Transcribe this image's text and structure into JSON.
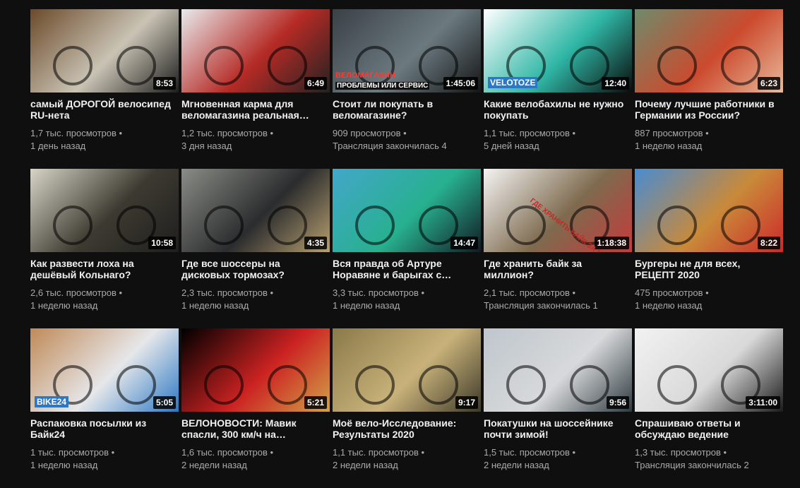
{
  "videos": [
    {
      "title": "самый ДОРОГОЙ велосипед RU-нета",
      "duration": "8:53",
      "views": "1,7 тыс. просмотров •",
      "age": "1 день назад",
      "thumb_colors": [
        "#6b4a2a",
        "#c9c3b4",
        "#1d1d1d"
      ]
    },
    {
      "title": "Мгновенная карма для веломагазина реальная…",
      "duration": "6:49",
      "views": "1,2 тыс. просмотров •",
      "age": "3 дня назад",
      "thumb_colors": [
        "#e9eaec",
        "#b52a25",
        "#222222"
      ]
    },
    {
      "title": "Стоит ли покупать в веломагазине?",
      "duration": "1:45:06",
      "views": "909 просмотров •",
      "age": "Трансляция закончилась 4",
      "thumb_colors": [
        "#3a4046",
        "#6b7a80",
        "#151515"
      ],
      "overlay_top": "ВЕЛОМАГАЗИН",
      "overlay_bottom": "ПРОБЛЕМЫ ИЛИ СЕРВИС"
    },
    {
      "title": "Какие велобахилы не нужно покупать",
      "duration": "12:40",
      "views": "1,1 тыс. просмотров •",
      "age": "5 дней назад",
      "thumb_colors": [
        "#ffffff",
        "#2fb6a5",
        "#0b0b0b"
      ],
      "overlay_logo": "VELOTOZE"
    },
    {
      "title": "Почему лучшие работники в Германии из России?",
      "duration": "6:23",
      "views": "887 просмотров •",
      "age": "1 неделю назад",
      "thumb_colors": [
        "#6f8b6a",
        "#cc4a2e",
        "#e8b99a"
      ]
    },
    {
      "title": "Как развести лоха на дешёвый Кольнаго?",
      "duration": "10:58",
      "views": "2,6 тыс. просмотров •",
      "age": "1 неделю назад",
      "thumb_colors": [
        "#d8d4c8",
        "#3c3a30",
        "#1e1e1e"
      ]
    },
    {
      "title": "Где все шоссеры на дисковых тормозах?",
      "duration": "4:35",
      "views": "2,3 тыс. просмотров •",
      "age": "1 неделю назад",
      "thumb_colors": [
        "#8a8c86",
        "#2b2c2e",
        "#b8a070"
      ]
    },
    {
      "title": "Вся правда об Артуре Норавяне и барыгах с…",
      "duration": "14:47",
      "views": "3,3 тыс. просмотров •",
      "age": "1 неделю назад",
      "thumb_colors": [
        "#43a7c9",
        "#27b08f",
        "#121a22"
      ]
    },
    {
      "title": "Где хранить байк за миллион?",
      "duration": "1:18:38",
      "views": "2,1 тыс. просмотров •",
      "age": "Трансляция закончилась 1",
      "thumb_colors": [
        "#f4f4f4",
        "#7e6a4e",
        "#c63b3b"
      ],
      "overlay_diag": "ГДЕ ХРАНИТЬ БАЙК ЗА МИЛЛИОН"
    },
    {
      "title": "Бургеры не для всех, РЕЦЕПТ 2020",
      "duration": "8:22",
      "views": "475 просмотров •",
      "age": "1 неделю назад",
      "thumb_colors": [
        "#4a8bd0",
        "#c98a3a",
        "#cc2a2a"
      ]
    },
    {
      "title": "Распаковка посылки из Байк24",
      "duration": "5:05",
      "views": "1 тыс. просмотров •",
      "age": "1 неделю назад",
      "thumb_colors": [
        "#c08a58",
        "#e6e7ea",
        "#2b78c4"
      ],
      "overlay_logo": "BIKE24"
    },
    {
      "title": "ВЕЛОНОВОСТИ: Мавик спасли, 300 км/ч на…",
      "duration": "5:21",
      "views": "1,6 тыс. просмотров •",
      "age": "2 недели назад",
      "thumb_colors": [
        "#000000",
        "#cc2222",
        "#d2a248"
      ]
    },
    {
      "title": "Моё вело-Исследование: Результаты 2020",
      "duration": "9:17",
      "views": "1,1 тыс. просмотров •",
      "age": "2 недели назад",
      "thumb_colors": [
        "#8a7a4a",
        "#c9b27a",
        "#3d3a2a"
      ]
    },
    {
      "title": "Покатушки на шоссейнике почти зимой!",
      "duration": "9:56",
      "views": "1,5 тыс. просмотров •",
      "age": "2 недели назад",
      "thumb_colors": [
        "#bfc6cc",
        "#d7d9db",
        "#2f3a40"
      ]
    },
    {
      "title": "Спрашиваю ответы и обсуждаю ведение",
      "duration": "3:11:00",
      "views": "1,3 тыс. просмотров •",
      "age": "Трансляция закончилась 2",
      "thumb_colors": [
        "#f2f2f2",
        "#d9d9d9",
        "#1b1b1b"
      ]
    }
  ]
}
